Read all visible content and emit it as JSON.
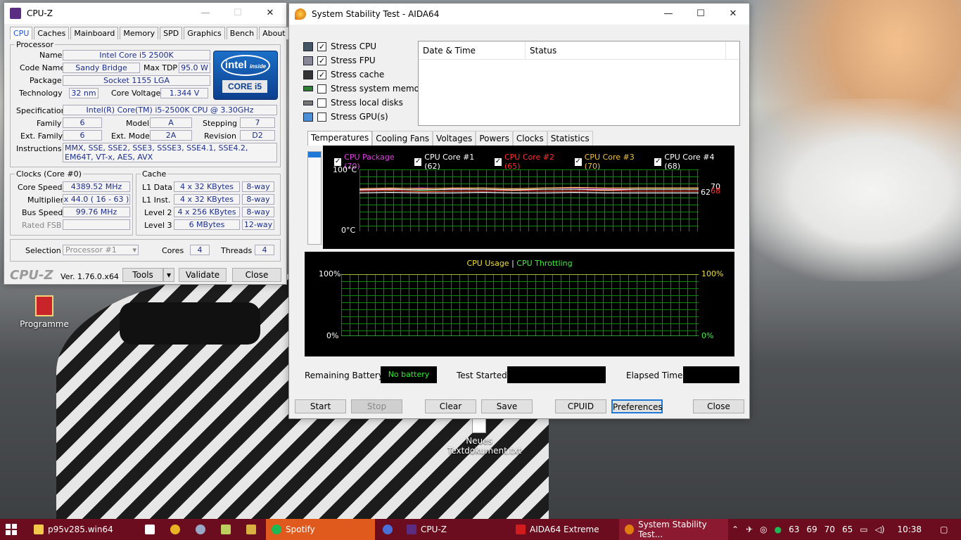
{
  "desktop": {
    "icons": [
      {
        "label": "Programme"
      },
      {
        "label": "Neues Textdokument.txt"
      }
    ]
  },
  "cpuz": {
    "title": "CPU-Z",
    "tabs": [
      "CPU",
      "Caches",
      "Mainboard",
      "Memory",
      "SPD",
      "Graphics",
      "Bench",
      "About"
    ],
    "processor_legend": "Processor",
    "labels": {
      "name": "Name",
      "code_name": "Code Name",
      "max_tdp": "Max TDP",
      "package": "Package",
      "technology": "Technology",
      "core_voltage": "Core Voltage",
      "specification": "Specification",
      "family": "Family",
      "model": "Model",
      "stepping": "Stepping",
      "ext_family": "Ext. Family",
      "ext_model": "Ext. Model",
      "revision": "Revision",
      "instructions": "Instructions"
    },
    "values": {
      "name": "Intel Core i5 2500K",
      "code_name": "Sandy Bridge",
      "max_tdp": "95.0 W",
      "package": "Socket 1155 LGA",
      "technology": "32 nm",
      "core_voltage": "1.344 V",
      "specification": "Intel(R) Core(TM) i5-2500K CPU @ 3.30GHz",
      "family": "6",
      "model": "A",
      "stepping": "7",
      "ext_family": "6",
      "ext_model": "2A",
      "revision": "D2",
      "instructions": "MMX, SSE, SSE2, SSE3, SSSE3, SSE4.1, SSE4.2, EM64T, VT-x, AES, AVX"
    },
    "intel_logo": {
      "word": "intel",
      "inside": "inside",
      "core": "CORE",
      "i5": "i5"
    },
    "clocks": {
      "legend": "Clocks (Core #0)",
      "rows": [
        {
          "label": "Core Speed",
          "value": "4389.52 MHz"
        },
        {
          "label": "Multiplier",
          "value": "x 44.0 ( 16 - 63 )"
        },
        {
          "label": "Bus Speed",
          "value": "99.76 MHz"
        },
        {
          "label": "Rated FSB",
          "value": ""
        }
      ]
    },
    "cache": {
      "legend": "Cache",
      "rows": [
        {
          "label": "L1 Data",
          "size": "4 x 32 KBytes",
          "way": "8-way"
        },
        {
          "label": "L1 Inst.",
          "size": "4 x 32 KBytes",
          "way": "8-way"
        },
        {
          "label": "Level 2",
          "size": "4 x 256 KBytes",
          "way": "8-way"
        },
        {
          "label": "Level 3",
          "size": "6 MBytes",
          "way": "12-way"
        }
      ]
    },
    "selection_label": "Selection",
    "selection_value": "Processor #1",
    "cores_label": "Cores",
    "cores_value": "4",
    "threads_label": "Threads",
    "threads_value": "4",
    "brand": "CPU-Z",
    "version": "Ver. 1.76.0.x64",
    "buttons": {
      "tools": "Tools",
      "validate": "Validate",
      "close": "Close"
    }
  },
  "aida": {
    "title": "System Stability Test - AIDA64",
    "stress": [
      {
        "label": "Stress CPU",
        "checked": true
      },
      {
        "label": "Stress FPU",
        "checked": true
      },
      {
        "label": "Stress cache",
        "checked": true
      },
      {
        "label": "Stress system memory",
        "checked": false
      },
      {
        "label": "Stress local disks",
        "checked": false
      },
      {
        "label": "Stress GPU(s)",
        "checked": false
      }
    ],
    "log_headers": {
      "date": "Date & Time",
      "status": "Status"
    },
    "tabs": [
      "Temperatures",
      "Cooling Fans",
      "Voltages",
      "Powers",
      "Clocks",
      "Statistics"
    ],
    "temp_legend": [
      {
        "label": "CPU Package (70)",
        "color": "#e040e0"
      },
      {
        "label": "CPU Core #1 (62)",
        "color": "#ffffff"
      },
      {
        "label": "CPU Core #2 (65)",
        "color": "#ff3030"
      },
      {
        "label": "CPU Core #3 (70)",
        "color": "#f0c040"
      },
      {
        "label": "CPU Core #4 (68)",
        "color": "#ffffff"
      }
    ],
    "temp_axis": {
      "max": "100°C",
      "min": "0°C",
      "right_a": "62",
      "right_b": "70",
      "right_c": "68"
    },
    "usage_title_a": "CPU Usage",
    "usage_sep": "|",
    "usage_title_b": "CPU Throttling",
    "usage_axis": {
      "left_max": "100%",
      "left_min": "0%",
      "right_max": "100%",
      "right_min": "0%"
    },
    "remaining_battery_label": "Remaining Battery:",
    "remaining_battery_value": "No battery",
    "test_started_label": "Test Started:",
    "elapsed_time_label": "Elapsed Time:",
    "buttons": {
      "start": "Start",
      "stop": "Stop",
      "clear": "Clear",
      "save": "Save",
      "cpuid": "CPUID",
      "preferences": "Preferences",
      "close": "Close"
    }
  },
  "chart_data": [
    {
      "type": "line",
      "title": "",
      "ylim": [
        0,
        100
      ],
      "ylabel": "°C",
      "series": [
        {
          "name": "CPU Package (70)",
          "values": [
            68,
            69,
            70,
            69,
            70,
            69,
            70,
            70,
            69,
            70,
            70,
            70
          ]
        },
        {
          "name": "CPU Core #1 (62)",
          "values": [
            62,
            63,
            62,
            62,
            63,
            62,
            62,
            63,
            62,
            62,
            62,
            62
          ]
        },
        {
          "name": "CPU Core #2 (65)",
          "values": [
            65,
            66,
            64,
            65,
            65,
            66,
            65,
            65,
            66,
            65,
            65,
            65
          ]
        },
        {
          "name": "CPU Core #3 (70)",
          "values": [
            69,
            70,
            69,
            70,
            70,
            69,
            70,
            71,
            70,
            70,
            70,
            70
          ]
        },
        {
          "name": "CPU Core #4 (68)",
          "values": [
            67,
            68,
            67,
            68,
            68,
            67,
            68,
            68,
            67,
            68,
            68,
            68
          ]
        }
      ]
    },
    {
      "type": "line",
      "title": "",
      "ylim": [
        0,
        100
      ],
      "series": [
        {
          "name": "CPU Usage",
          "values": [
            100,
            100,
            100,
            100,
            100,
            100,
            100,
            100,
            100,
            100,
            100,
            100
          ]
        },
        {
          "name": "CPU Throttling",
          "values": [
            0,
            0,
            0,
            0,
            0,
            0,
            0,
            0,
            0,
            0,
            0,
            0
          ]
        }
      ]
    }
  ],
  "taskbar": {
    "items": [
      {
        "label": "p95v285.win64"
      },
      {
        "label": "Spotify"
      },
      {
        "label": "CPU-Z"
      },
      {
        "label": "AIDA64 Extreme"
      },
      {
        "label": "System Stability Test..."
      }
    ],
    "tray_temps": [
      "63",
      "69",
      "70",
      "65"
    ],
    "time": "10:38"
  }
}
